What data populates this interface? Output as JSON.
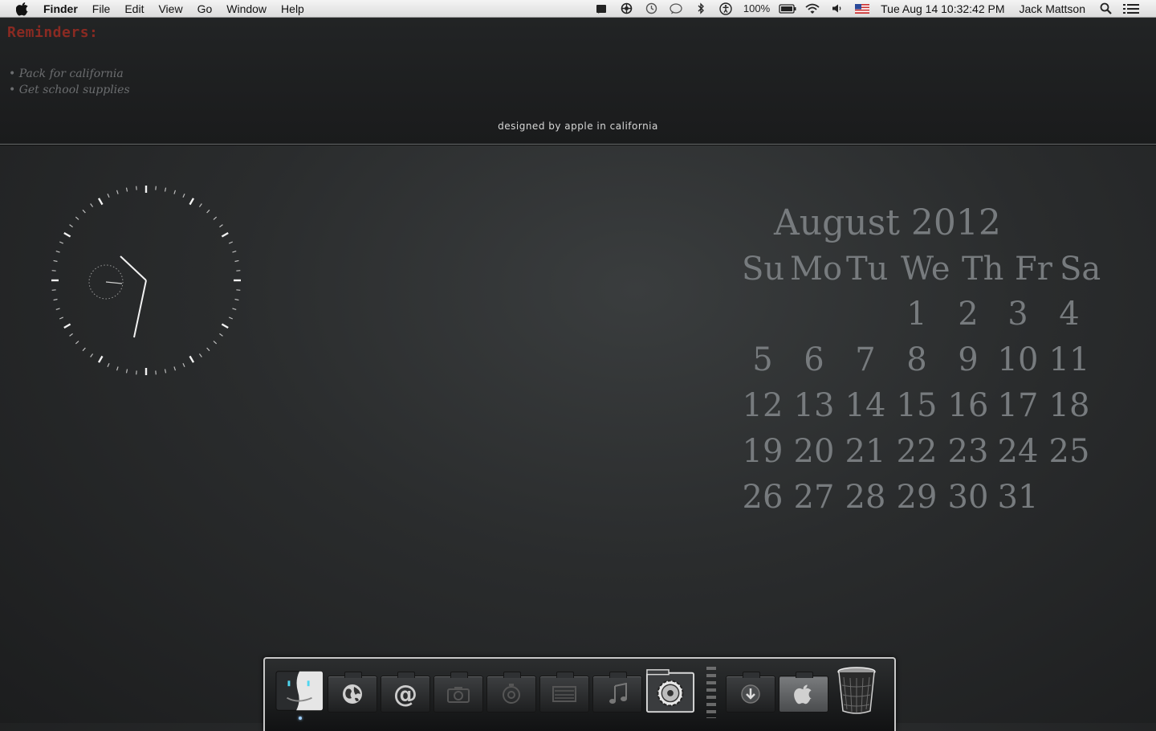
{
  "menubar": {
    "app_name": "Finder",
    "menus": [
      "File",
      "Edit",
      "View",
      "Go",
      "Window",
      "Help"
    ],
    "battery": "100%",
    "datetime": "Tue Aug 14  10:32:42 PM",
    "user": "Jack Mattson",
    "status_icons": [
      "notification-icon",
      "sync-icon",
      "time-machine-icon",
      "chat-icon",
      "bluetooth-icon",
      "accessibility-icon",
      "battery-icon",
      "wifi-icon",
      "volume-icon",
      "us-flag-icon",
      "spotlight-icon",
      "list-icon"
    ]
  },
  "widgets": {
    "reminders_title": "Reminders:",
    "reminders": [
      "• Pack for california",
      "• Get school supplies"
    ],
    "tagline": "designed by apple in california"
  },
  "calendar": {
    "title": "August 2012",
    "weekdays": [
      "Su",
      "Mo",
      "Tu",
      "We",
      "Th",
      "Fr",
      "Sa"
    ],
    "days": [
      "1",
      "2",
      "3",
      "4",
      "5",
      "6",
      "7",
      "8",
      "9",
      "10",
      "11",
      "12",
      "13",
      "14",
      "15",
      "16",
      "17",
      "18",
      "19",
      "20",
      "21",
      "22",
      "23",
      "24",
      "25",
      "26",
      "27",
      "28",
      "29",
      "30",
      "31"
    ],
    "first_weekday_index": 3
  },
  "clock": {
    "hour": 10,
    "minute": 32,
    "second": 42
  },
  "dock": {
    "items": [
      "finder-icon",
      "globe-icon",
      "mail-icon",
      "camera-icon",
      "timer-icon",
      "clapperboard-icon",
      "music-icon",
      "system-preferences-icon",
      "downloads-icon",
      "applications-icon",
      "trash-icon"
    ]
  }
}
